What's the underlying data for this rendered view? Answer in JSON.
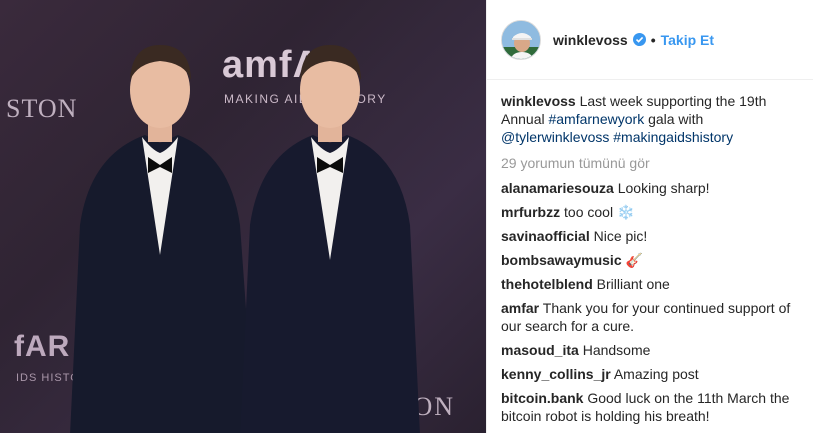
{
  "photo": {
    "logo_big": "amfAR",
    "logo_tag": "MAKING AIDS HISTORY",
    "ston_left": "STON",
    "fa": "fAR",
    "hist": "IDS HISTOR",
    "ston_right": "HARRY WINSTON"
  },
  "header": {
    "username": "winklevoss",
    "separator": "•",
    "follow_label": "Takip Et"
  },
  "caption": {
    "user": "winklevoss",
    "text_1": "Last week supporting the 19th Annual",
    "hashtag_1": "#amfarnewyork",
    "text_2": "gala with",
    "mention": "@tylerwinklevoss",
    "hashtag_2": "#makingaidshistory"
  },
  "view_all": "29 yorumun tümünü gör",
  "comments": [
    {
      "user": "alanamariesouza",
      "text": "Looking sharp!"
    },
    {
      "user": "mrfurbzz",
      "text": "too cool ❄️"
    },
    {
      "user": "savinaofficial",
      "text": "Nice pic!"
    },
    {
      "user": "bombsawaymusic",
      "text": "🎸"
    },
    {
      "user": "thehotelblend",
      "text": "Brilliant one"
    },
    {
      "user": "amfar",
      "text": "Thank you for your continued support of our search for a cure."
    },
    {
      "user": "masoud_ita",
      "text": "Handsome"
    },
    {
      "user": "kenny_collins_jr",
      "text": "Amazing post"
    },
    {
      "user": "bitcoin.bank",
      "text": "Good luck on the 11th March the bitcoin robot is holding his breath!"
    }
  ],
  "colors": {
    "accent": "#3897f0",
    "hashtag": "#003569",
    "muted": "#999999"
  }
}
